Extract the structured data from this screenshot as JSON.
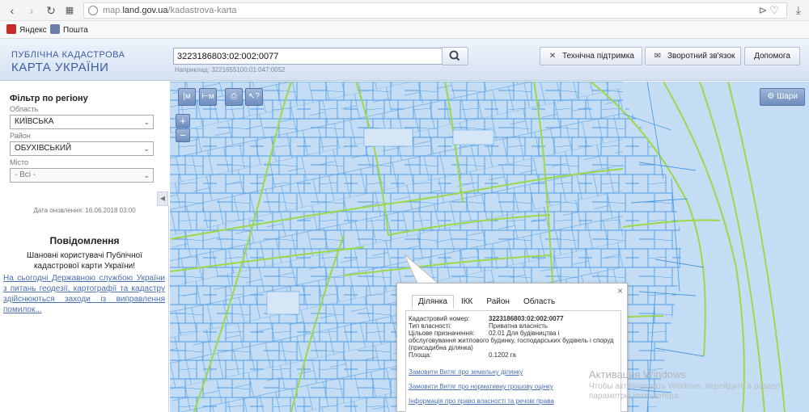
{
  "browser": {
    "url_prefix": "map.",
    "url_domain": "land.gov.ua",
    "url_path": "/kadastrova-karta",
    "bookmarks": [
      {
        "label": "Яндекс",
        "color": "#c62b2b"
      },
      {
        "label": "Пошта",
        "color": "#6b7fa8"
      }
    ]
  },
  "header": {
    "logo_line1": "ПУБЛІЧНА КАДАСТРОВА",
    "logo_line2": "КАРТА УКРАЇНИ",
    "search_value": "3223186803:02:002:0077",
    "search_hint": "Наприклад: 3221655100:01:047:0052",
    "support_label": "Технічна підтримка",
    "feedback_label": "Зворотний зв'язок",
    "help_label": "Допомога"
  },
  "filter": {
    "title": "Фільтр по регіону",
    "region_label": "Область",
    "region_value": "КИЇВСЬКА",
    "district_label": "Район",
    "district_value": "ОБУХІВСЬКИЙ",
    "city_label": "Місто",
    "city_value": "- Всі -"
  },
  "updated": "Дата оновлення: 16.06.2018 03:00",
  "news": {
    "title": "Повідомлення",
    "text": "Шановні користувачі Публічної кадастрової карти України!",
    "link": "На сьогодні Державною службою України з питань геодезії, картографії та кадастру здійснюються заходи із виправлення помилок..."
  },
  "map": {
    "tool_labels": [
      "|м",
      "⊢м",
      "⎙",
      "↖?"
    ],
    "zoom_in": "+",
    "zoom_out": "−",
    "layers_label": "Шари"
  },
  "popup": {
    "tabs": [
      "Ділянка",
      "ІКК",
      "Район",
      "Область"
    ],
    "active_tab": "Ділянка",
    "cadastral_label": "Кадастровий номер:",
    "cadastral_value": "3223186803:02:002:0077",
    "ownership_label": "Тип власності:",
    "ownership_value": "Приватна власність",
    "purpose_label": "Цільове призначення:",
    "purpose_value": "02.01 Для будівництва і",
    "purpose_cont": "обслуговування житлового будинку, господарських будівель і споруд (присадибна ділянка)",
    "area_label": "Площа:",
    "area_value": "0.1202 га",
    "link1": "Замовити Витяг про земельну ділянку",
    "link2": "Замовити Витяг про нормативну грошову оцінку",
    "link3": "Інформація про право власності та речові права"
  },
  "watermark": {
    "line1": "Активация Windows",
    "line2": "Чтобы активировать Windows, перейдите в раздел параметры компьютера."
  },
  "colors": {
    "map_bg": "#c4ddf4",
    "parcel_line": "#4f9ce3",
    "road_line": "#9bd84a",
    "link": "#4a6fb4",
    "header_text": "#3b5ea3"
  }
}
